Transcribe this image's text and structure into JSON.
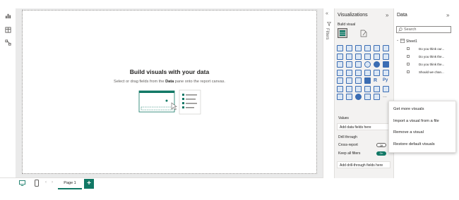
{
  "canvas": {
    "title": "Build visuals with your data",
    "subtitle_pre": "Select or drag fields from the ",
    "subtitle_bold": "Data",
    "subtitle_post": " pane onto the report canvas."
  },
  "bottom_bar": {
    "page_tab": "Page 1",
    "add_page": "+"
  },
  "filters": {
    "label": "Filters"
  },
  "visualizations": {
    "title": "Visualizations",
    "collapse_icon": "chevron-double-right",
    "build_visual": "Build visual",
    "values_label": "Values",
    "add_data_fields": "Add data fields here",
    "drill_through": "Drill through",
    "cross_report": "Cross-report",
    "cross_report_state": "Off",
    "keep_all_filters": "Keep all filters",
    "keep_all_filters_state": "On",
    "add_drill_fields": "Add drill-through fields here",
    "more_label": "..."
  },
  "data_pane": {
    "title": "Data",
    "search_placeholder": "Search",
    "table_name": "Sheet1",
    "fields": [
      "Do you think our...",
      "Do you think the...",
      "Do you think the...",
      "Should we chan..."
    ]
  },
  "context_menu": {
    "items": [
      "Get more visuals",
      "Import a visual from a file",
      "Remove a visual",
      "Restore default visuals"
    ]
  },
  "colors": {
    "accent_green": "#117865",
    "visual_blue": "#3b6db3",
    "pane_bg": "#f3f2f1"
  }
}
